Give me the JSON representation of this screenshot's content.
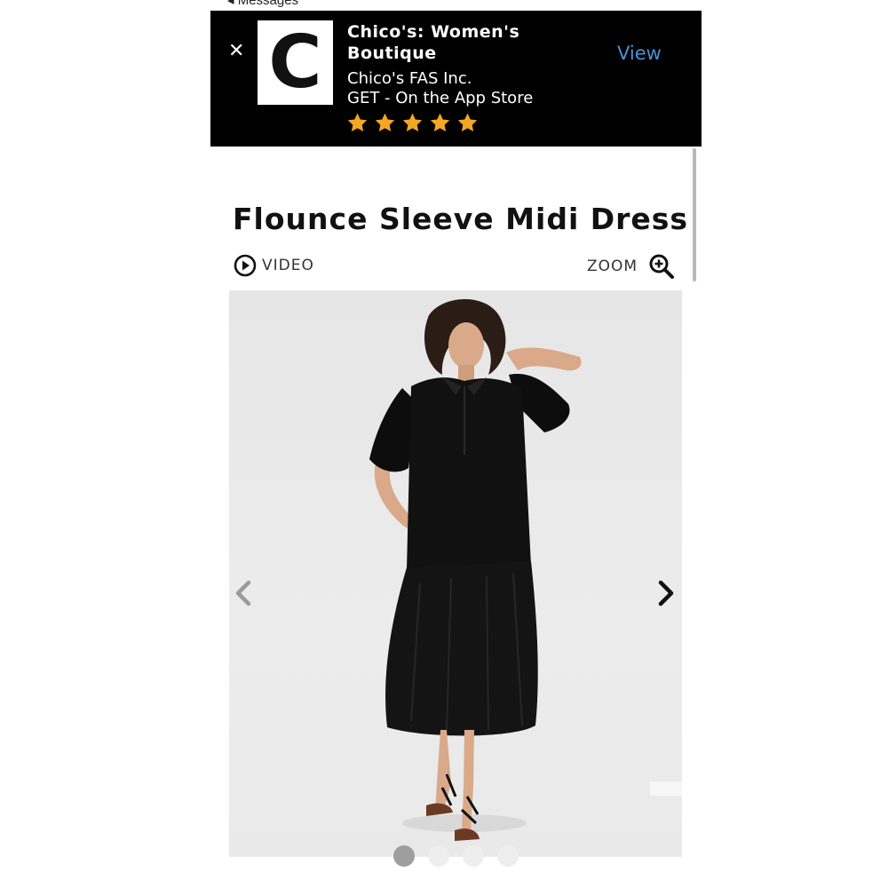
{
  "status_bar": {
    "back_label": "◂ Messages"
  },
  "app_banner": {
    "title": "Chico's: Women's Boutique",
    "publisher": "Chico's FAS Inc.",
    "store_line": "GET - On the App Store",
    "rating_stars": 5,
    "view_label": "View",
    "logo_letter": "C",
    "star_color": "#f5a623",
    "view_color": "#4a90d9"
  },
  "product": {
    "title": "Flounce Sleeve Midi Dress",
    "video_label": "VIDEO",
    "zoom_label": "ZOOM"
  },
  "carousel": {
    "dot_count": 4,
    "active_index": 0
  }
}
